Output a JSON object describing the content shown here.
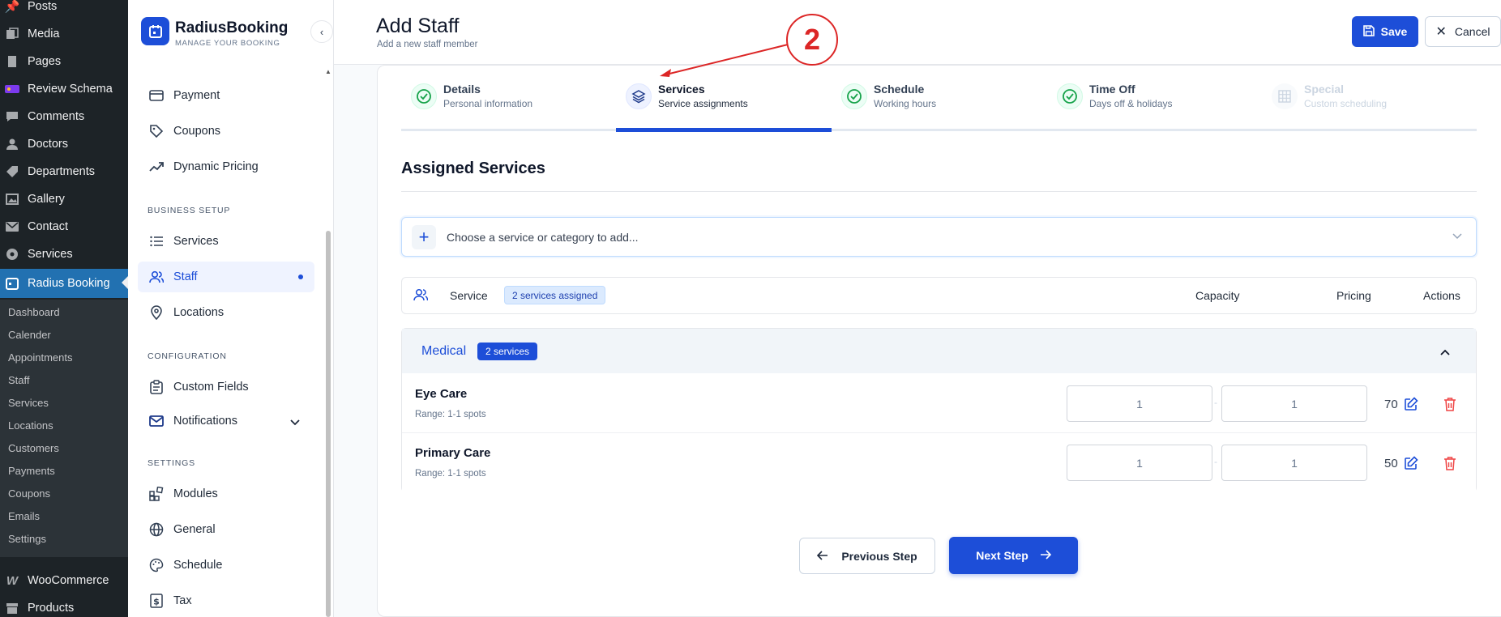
{
  "wp_menu": [
    {
      "label": "Posts",
      "icon": "pin-icon"
    },
    {
      "label": "Media",
      "icon": "media-icon"
    },
    {
      "label": "Pages",
      "icon": "page-icon"
    },
    {
      "label": "Review Schema",
      "icon": "review-icon"
    },
    {
      "label": "Comments",
      "icon": "comment-icon"
    },
    {
      "label": "Doctors",
      "icon": "person-icon"
    },
    {
      "label": "Departments",
      "icon": "tag-icon"
    },
    {
      "label": "Gallery",
      "icon": "gallery-icon"
    },
    {
      "label": "Contact",
      "icon": "mail-icon"
    },
    {
      "label": "Services",
      "icon": "settings-icon"
    },
    {
      "label": "Radius Booking",
      "icon": "calendar-icon",
      "active": true
    }
  ],
  "wp_submenu": [
    "Dashboard",
    "Calender",
    "Appointments",
    "Staff",
    "Services",
    "Locations",
    "Customers",
    "Payments",
    "Coupons",
    "Emails",
    "Settings"
  ],
  "wp_menu_bottom": [
    {
      "label": "WooCommerce",
      "icon": "woo-icon"
    },
    {
      "label": "Products",
      "icon": "archive-icon"
    }
  ],
  "brand": {
    "name": "RadiusBooking",
    "tagline": "MANAGE YOUR BOOKING"
  },
  "plugin_nav": {
    "items_top": [
      {
        "label": "Payment",
        "icon": "card-icon"
      },
      {
        "label": "Coupons",
        "icon": "tag-icon"
      },
      {
        "label": "Dynamic Pricing",
        "icon": "trend-icon"
      }
    ],
    "section_business": "BUSINESS SETUP",
    "items_business": [
      {
        "label": "Services",
        "icon": "list-icon"
      },
      {
        "label": "Staff",
        "icon": "users-icon",
        "active": true
      },
      {
        "label": "Locations",
        "icon": "map-pin-icon"
      }
    ],
    "section_config": "CONFIGURATION",
    "items_config": [
      {
        "label": "Custom Fields",
        "icon": "clipboard-icon"
      },
      {
        "label": "Notifications",
        "icon": "mail-icon"
      }
    ],
    "section_settings": "SETTINGS",
    "items_settings": [
      {
        "label": "Modules",
        "icon": "blocks-icon"
      },
      {
        "label": "General",
        "icon": "globe-icon"
      },
      {
        "label": "Schedule",
        "icon": "palette-icon"
      },
      {
        "label": "Tax",
        "icon": "dollar-icon"
      }
    ]
  },
  "page": {
    "title": "Add Staff",
    "subtitle": "Add a new staff member",
    "save_label": "Save",
    "cancel_label": "Cancel"
  },
  "steps": [
    {
      "title": "Details",
      "subtitle": "Personal information",
      "state": "done"
    },
    {
      "title": "Services",
      "subtitle": "Service assignments",
      "state": "current"
    },
    {
      "title": "Schedule",
      "subtitle": "Working hours",
      "state": "done"
    },
    {
      "title": "Time Off",
      "subtitle": "Days off & holidays",
      "state": "done"
    },
    {
      "title": "Special",
      "subtitle": "Custom scheduling",
      "state": "disabled"
    }
  ],
  "section": {
    "title": "Assigned Services",
    "select_placeholder": "Choose a service or category to add..."
  },
  "table": {
    "col_service": "Service",
    "assigned_badge": "2 services assigned",
    "col_capacity": "Capacity",
    "col_pricing": "Pricing",
    "col_actions": "Actions"
  },
  "group": {
    "name": "Medical",
    "count_badge": "2 services",
    "rows": [
      {
        "name": "Eye Care",
        "range": "Range: 1-1 spots",
        "cap_min": "1",
        "cap_max": "1",
        "price": "70"
      },
      {
        "name": "Primary Care",
        "range": "Range: 1-1 spots",
        "cap_min": "1",
        "cap_max": "1",
        "price": "50"
      }
    ]
  },
  "footer": {
    "prev_label": "Previous Step",
    "next_label": "Next Step"
  },
  "annotation": {
    "number": "2"
  },
  "colors": {
    "accent": "#1d4ed8",
    "wp_active": "#2271b1",
    "success": "#16a34a",
    "danger": "#ef4444",
    "annotation": "#dc2626"
  }
}
